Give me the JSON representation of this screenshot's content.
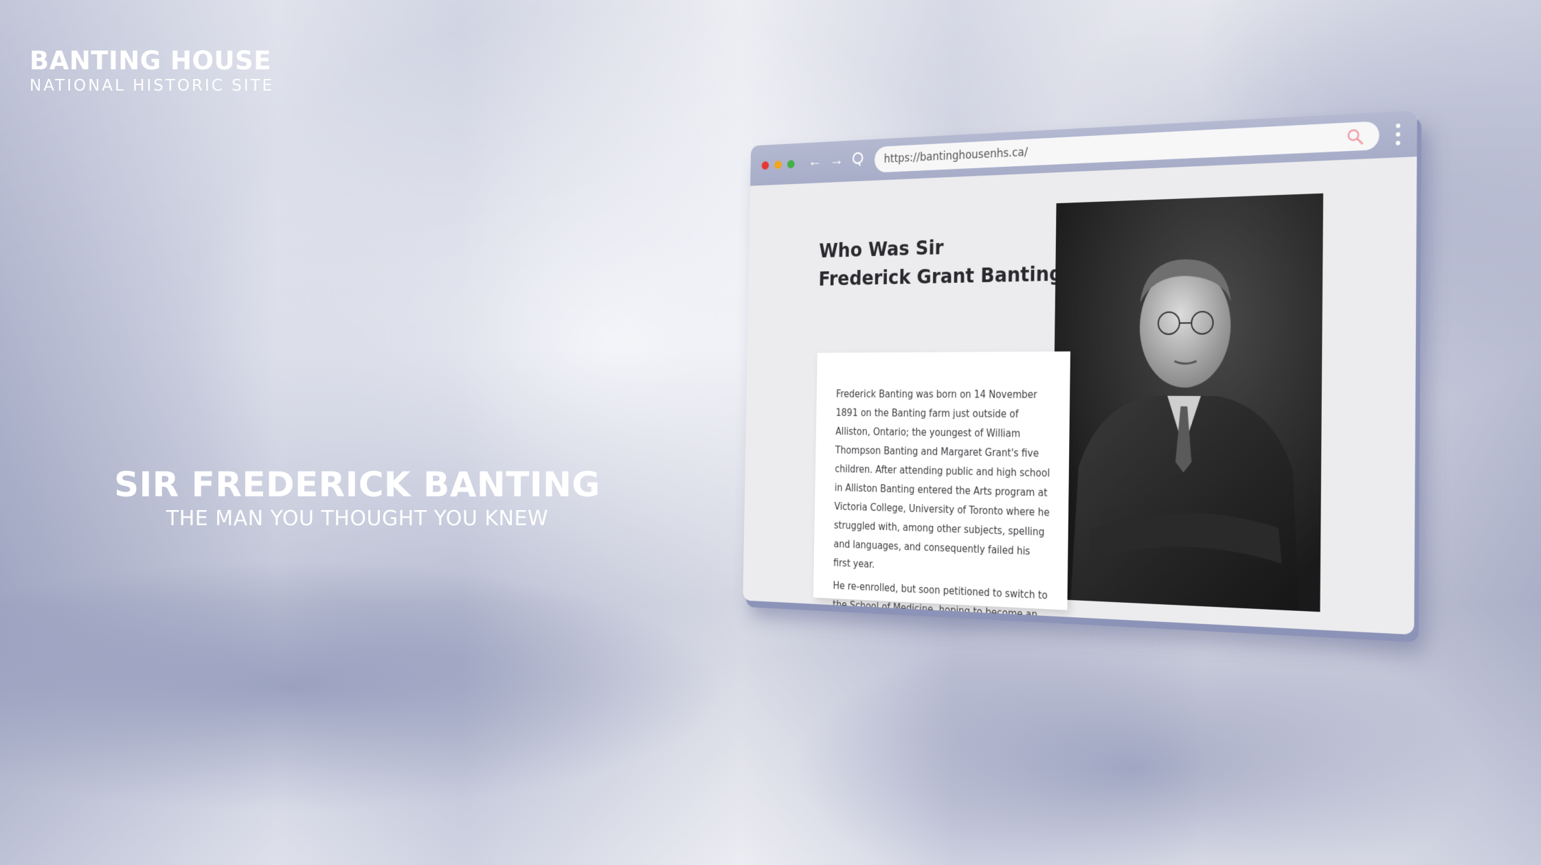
{
  "logo": {
    "title": "BANTING HOUSE",
    "subtitle": "NATIONAL HISTORIC SITE"
  },
  "hero": {
    "title": "SIR FREDERICK BANTING",
    "subtitle": "THE MAN YOU THOUGHT YOU KNEW"
  },
  "browser": {
    "url": "https://bantinghousenhs.ca/",
    "window_dot_colors": [
      "#e53935",
      "#f4a51c",
      "#43b047"
    ],
    "toolbar_icons": [
      "back-arrow-icon",
      "forward-arrow-icon",
      "reload-icon",
      "search-icon",
      "more-vertical-icon"
    ],
    "heading_line1": "Who Was Sir",
    "heading_line2": "Frederick Grant Banting?",
    "paragraph1": "Frederick Banting was born on 14 November 1891 on the Banting farm just outside of Alliston, Ontario; the youngest of William Thompson Banting and Margaret Grant's five children. After attending public and high school in Alliston Banting entered the Arts program at Victoria College, University of Toronto where he struggled with, among other subjects, spelling and languages, and consequently failed his first year.",
    "paragraph2": "He re-enrolled, but soon petitioned to switch to the School of Medicine, hoping to become an Orthopaedic Surgeon."
  },
  "colors": {
    "toolbar": "#aab0ca",
    "page_background": "#ececee",
    "text_primary": "#2a2a2e"
  }
}
